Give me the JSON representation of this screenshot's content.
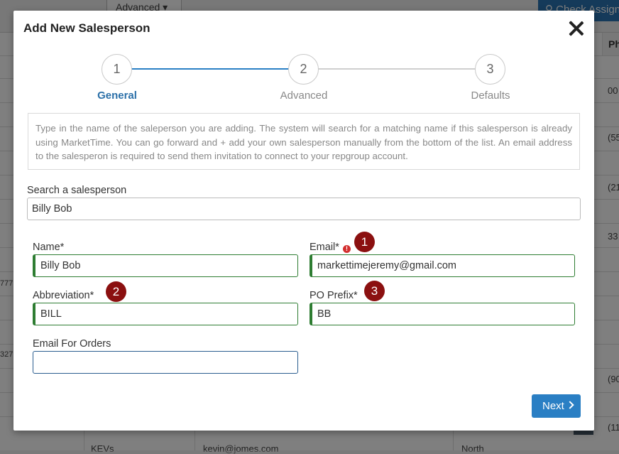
{
  "background": {
    "advanced_label": "Advanced",
    "check_label": "Check Assign",
    "col_header": "Ph",
    "cells": [
      "00",
      "(55",
      "(21",
      "33",
      "(90",
      "(11"
    ],
    "left_cells": [
      "777",
      "327"
    ],
    "bottom_cells": [
      "KEVs",
      "kevin@jomes.com",
      "North"
    ]
  },
  "modal": {
    "title": "Add New Salesperson",
    "steps": [
      {
        "number": "1",
        "label": "General",
        "active": true
      },
      {
        "number": "2",
        "label": "Advanced",
        "active": false
      },
      {
        "number": "3",
        "label": "Defaults",
        "active": false
      }
    ],
    "info_text": "Type in the name of the saleperson you are adding. The system will search for a matching name if this salesperson is already using MarketTime. You can go forward and + add your own salesperson manually from the bottom of the list. An email address to the salesperon is required to send them invitation to connect to your repgroup account.",
    "search": {
      "label": "Search a salesperson",
      "value": "Billy Bob"
    },
    "fields": {
      "name": {
        "label": "Name*",
        "value": "Billy Bob"
      },
      "email": {
        "label": "Email*",
        "value": "markettimejeremy@gmail.com"
      },
      "abbreviation": {
        "label": "Abbreviation*",
        "value": "BILL"
      },
      "po_prefix": {
        "label": "PO Prefix*",
        "value": "BB"
      },
      "email_for_orders": {
        "label": "Email For Orders",
        "value": ""
      }
    },
    "badges": [
      "1",
      "2",
      "3"
    ],
    "error_icon": "!",
    "next_label": "Next"
  },
  "colors": {
    "accent": "#2a7fc4",
    "active_step": "#2a6fa8",
    "valid_border": "#2e7d32",
    "badge": "#8b1010"
  }
}
